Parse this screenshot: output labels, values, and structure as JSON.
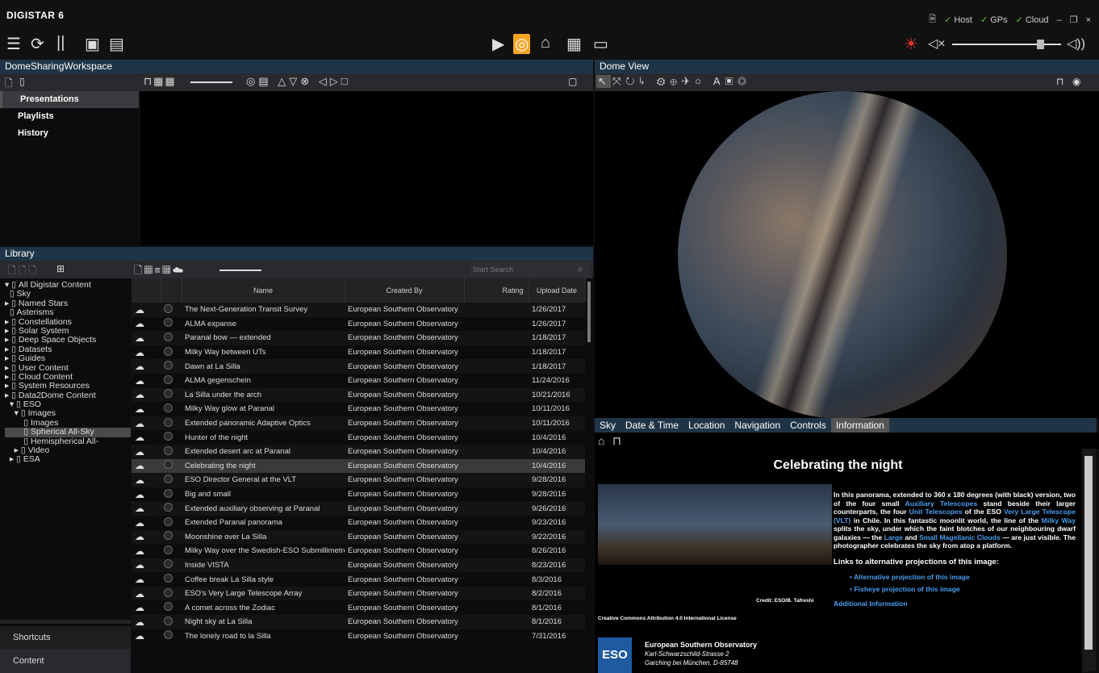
{
  "app": {
    "brand": "DIGISTAR 6"
  },
  "status": [
    {
      "label": "Host"
    },
    {
      "label": "GPs"
    },
    {
      "label": "Cloud"
    }
  ],
  "workspace": {
    "title": "DomeSharingWorkspace",
    "nav": [
      "Presentations",
      "Playlists",
      "History"
    ]
  },
  "library": {
    "title": "Library",
    "search_placeholder": "Start Search",
    "tree": [
      "All Digistar Content",
      "Sky",
      "Named Stars",
      "Asterisms",
      "Constellations",
      "Solar System",
      "Deep Space Objects",
      "Datasets",
      "Guides",
      "User Content",
      "Cloud Content",
      "System Resources",
      "Data2Dome Content",
      "ESO",
      "Images",
      "Images",
      "Spherical All-Sky",
      "Hemispherical All-",
      "Video",
      "ESA"
    ],
    "tree_prefix": [
      "▾ ",
      "  ",
      "▸ ",
      "  ",
      "▸ ",
      "▸ ",
      "▸ ",
      "▸ ",
      "▸ ",
      "▸ ",
      "▸ ",
      "▸ ",
      "▸ ",
      "  ▾ ",
      "    ▾ ",
      "        ",
      "        ",
      "        ",
      "    ▸ ",
      "  ▸ "
    ],
    "columns": [
      "Name",
      "Created By",
      "Rating",
      "Upload Date"
    ],
    "rows": [
      {
        "name": "The Next-Generation Transit Survey",
        "by": "European Southern Observatory",
        "date": "1/26/2017"
      },
      {
        "name": "ALMA expanse",
        "by": "European Southern Observatory",
        "date": "1/26/2017"
      },
      {
        "name": "Paranal bow — extended",
        "by": "European Southern Observatory",
        "date": "1/18/2017"
      },
      {
        "name": "Milky Way between UTs",
        "by": "European Southern Observatory",
        "date": "1/18/2017"
      },
      {
        "name": "Dawn at La Silla",
        "by": "European Southern Observatory",
        "date": "1/18/2017"
      },
      {
        "name": "ALMA gegenschein",
        "by": "European Southern Observatory",
        "date": "11/24/2016"
      },
      {
        "name": "La Silla under the arch",
        "by": "European Southern Observatory",
        "date": "10/21/2016"
      },
      {
        "name": "Milky Way glow at Paranal",
        "by": "European Southern Observatory",
        "date": "10/11/2016"
      },
      {
        "name": "Extended panoramic Adaptive Optics",
        "by": "European Southern Observatory",
        "date": "10/11/2016"
      },
      {
        "name": "Hunter of the night",
        "by": "European Southern Observatory",
        "date": "10/4/2016"
      },
      {
        "name": "Extended desert arc at Paranal",
        "by": "European Southern Observatory",
        "date": "10/4/2016"
      },
      {
        "name": "Celebrating the night",
        "by": "European Southern Observatory",
        "date": "10/4/2016"
      },
      {
        "name": "ESO Director General at the VLT",
        "by": "European Southern Observatory",
        "date": "9/28/2016"
      },
      {
        "name": "Big and small",
        "by": "European Southern Observatory",
        "date": "9/28/2016"
      },
      {
        "name": "Extended auxiliary observing at Paranal",
        "by": "European Southern Observatory",
        "date": "9/26/2016"
      },
      {
        "name": "Extended Paranal panorama",
        "by": "European Southern Observatory",
        "date": "9/23/2016"
      },
      {
        "name": "Moonshine over La Silla",
        "by": "European Southern Observatory",
        "date": "9/22/2016"
      },
      {
        "name": "Milky Way over the Swedish-ESO Submillimetre",
        "by": "European Southern Observatory",
        "date": "8/26/2016"
      },
      {
        "name": "Inside VISTA",
        "by": "European Southern Observatory",
        "date": "8/23/2016"
      },
      {
        "name": "Coffee break La Silla style",
        "by": "European Southern Observatory",
        "date": "8/3/2016"
      },
      {
        "name": "ESO's Very Large Telescope Array",
        "by": "European Southern Observatory",
        "date": "8/2/2016"
      },
      {
        "name": "A comet across the Zodiac",
        "by": "European Southern Observatory",
        "date": "8/1/2016"
      },
      {
        "name": "Night sky at La Silla",
        "by": "European Southern Observatory",
        "date": "8/1/2016"
      },
      {
        "name": "The lonely road to la Silla",
        "by": "European Southern Observatory",
        "date": "7/31/2016"
      }
    ],
    "bottom": [
      "Shortcuts",
      "Content"
    ]
  },
  "dome": {
    "title": "Dome View"
  },
  "info_tabs": [
    "Sky",
    "Date & Time",
    "Location",
    "Navigation",
    "Controls",
    "Information"
  ],
  "info": {
    "title": "Celebrating the night",
    "body_1": "In this panorama, extended to 360 x 180 degrees (with black) version, two of the four small ",
    "link_1": "Auxiliary Telescopes",
    "body_2": " stand beside their larger counterparts, the four ",
    "link_2": "Unit Telescopes",
    "body_3": " of the ESO ",
    "link_3": "Very Large Telescope (VLT)",
    "body_4": " in Chile. In this fantastic moonlit world, the line of the ",
    "link_4": "Milky Way",
    "body_5": " splits the sky, under which the faint blotches of our neighbouring dwarf galaxies — the ",
    "link_5": "Large",
    "body_6": " and ",
    "link_6": "Small Magellanic Clouds",
    "body_7": " — are just visible. The photographer celebrates the sky from atop a platform.",
    "links_heading": "Links to alternative projections of this image:",
    "alt_links": [
      "Alternative projection of this image",
      "Fisheye projection of this image"
    ],
    "credit": "Credit: ESO/B. Tafreshi",
    "additional": "Additional Information",
    "license": "Creative Commons Attribution 4.0 International License",
    "org_name": "European Southern Observatory",
    "org_addr1": "Karl-Schwarzschild-Strasse 2",
    "org_addr2": "Garching bei München, D-85748",
    "org_logo": "ESO"
  },
  "colors": {
    "accent": "#f5a623",
    "panel_head": "#1f3547",
    "link": "#4a9ef0",
    "ok": "#6cc04a"
  }
}
